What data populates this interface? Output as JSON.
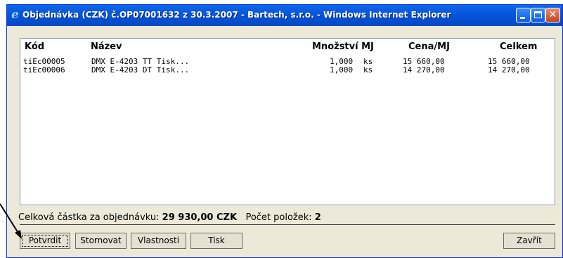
{
  "window": {
    "title": "Objednávka (CZK) č.OP07001632 z 30.3.2007 - Bartech, s.r.o. - Windows Internet Explorer"
  },
  "table": {
    "headers": {
      "code": "Kód",
      "name": "Název",
      "qty": "Množství MJ",
      "price": "Cena/MJ",
      "total": "Celkem"
    },
    "rows": [
      {
        "code": "tiEc00005",
        "name": "DMX E-4203 TT Tisk...",
        "qty": "1,000",
        "unit": "ks",
        "price": "15 660,00",
        "total": "15 660,00"
      },
      {
        "code": "tiEc00006",
        "name": "DMX E-4203 DT Tisk...",
        "qty": "1,000",
        "unit": "ks",
        "price": "14 270,00",
        "total": "14 270,00"
      }
    ]
  },
  "summary": {
    "total_label": "Celková částka za objednávku:",
    "total_value": "29 930,00 CZK",
    "count_label": "Počet položek:",
    "count_value": "2"
  },
  "buttons": {
    "confirm": "Potvrdit",
    "cancel": "Stornovat",
    "properties": "Vlastnosti",
    "print": "Tisk",
    "close": "Zavřít"
  },
  "icons": [
    "ie-logo-icon",
    "minimize-icon",
    "maximize-icon",
    "close-icon",
    "pointer-arrow-icon"
  ]
}
